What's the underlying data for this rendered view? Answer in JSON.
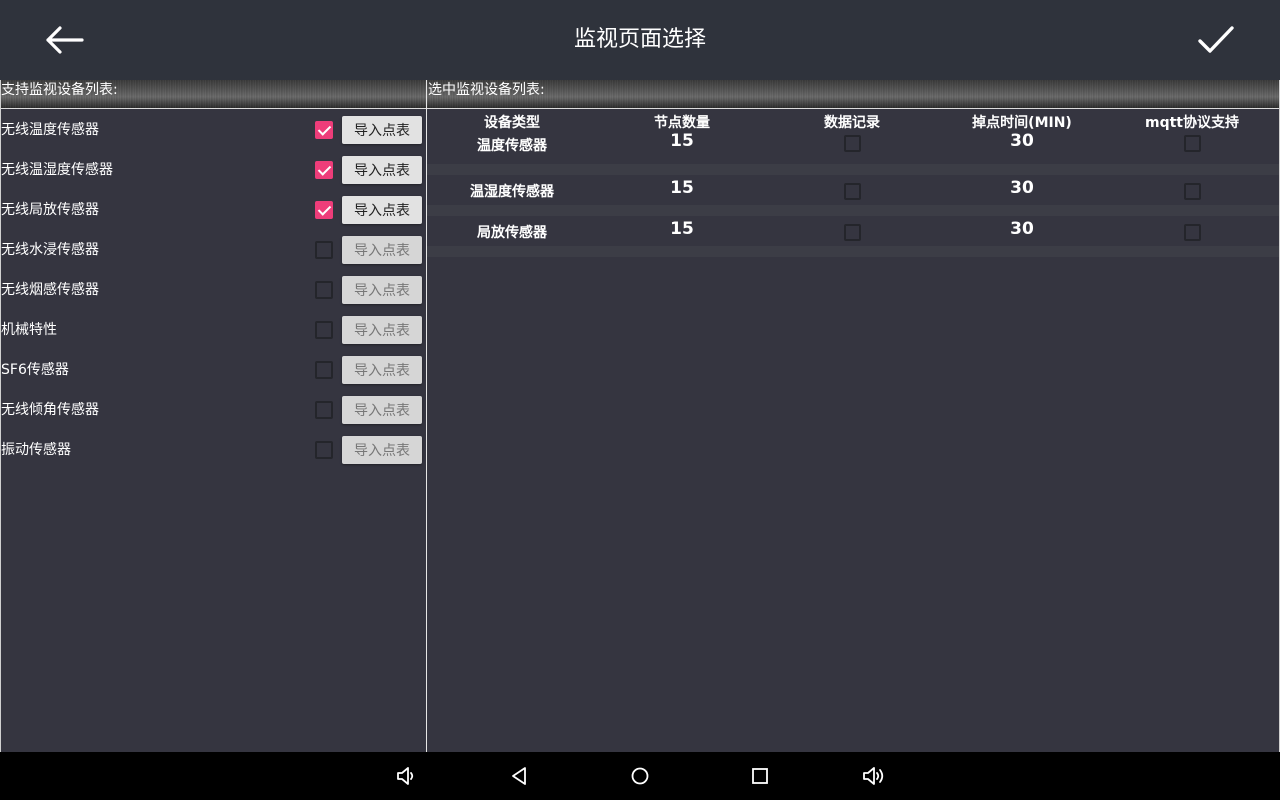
{
  "header": {
    "title": "监视页面选择",
    "back_icon": "arrow-left-icon",
    "confirm_icon": "check-icon"
  },
  "left_panel": {
    "title": "支持监视设备列表:",
    "items": [
      {
        "label": "无线温度传感器",
        "checked": true,
        "button": "导入点表",
        "button_enabled": true
      },
      {
        "label": "无线温湿度传感器",
        "checked": true,
        "button": "导入点表",
        "button_enabled": true
      },
      {
        "label": "无线局放传感器",
        "checked": true,
        "button": "导入点表",
        "button_enabled": true
      },
      {
        "label": "无线水浸传感器",
        "checked": false,
        "button": "导入点表",
        "button_enabled": false
      },
      {
        "label": "无线烟感传感器",
        "checked": false,
        "button": "导入点表",
        "button_enabled": false
      },
      {
        "label": "机械特性",
        "checked": false,
        "button": "导入点表",
        "button_enabled": false
      },
      {
        "label": "SF6传感器",
        "checked": false,
        "button": "导入点表",
        "button_enabled": false
      },
      {
        "label": "无线倾角传感器",
        "checked": false,
        "button": "导入点表",
        "button_enabled": false
      },
      {
        "label": "振动传感器",
        "checked": false,
        "button": "导入点表",
        "button_enabled": false
      }
    ]
  },
  "right_panel": {
    "title": "选中监视设备列表:",
    "columns": [
      "设备类型",
      "节点数量",
      "数据记录",
      "掉点时间(MIN)",
      "mqtt协议支持"
    ],
    "rows": [
      {
        "type": "温度传感器",
        "nodes": "15",
        "data_record": false,
        "drop_time": "30",
        "mqtt": false
      },
      {
        "type": "温湿度传感器",
        "nodes": "15",
        "data_record": false,
        "drop_time": "30",
        "mqtt": false
      },
      {
        "type": "局放传感器",
        "nodes": "15",
        "data_record": false,
        "drop_time": "30",
        "mqtt": false
      }
    ]
  },
  "colors": {
    "accent": "#ee3d7a",
    "background": "#353540",
    "topbar": "#2f333c",
    "navbar": "#000000"
  },
  "navbar": {
    "icons": [
      "volume-down-icon",
      "back-triangle-icon",
      "home-circle-icon",
      "recents-square-icon",
      "volume-up-icon"
    ]
  }
}
